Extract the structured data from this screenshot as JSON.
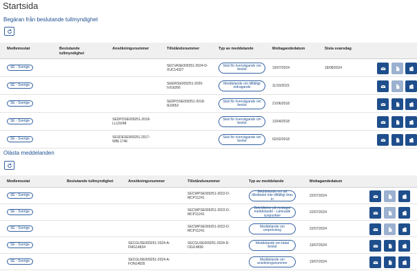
{
  "page_title": "Startsida",
  "section1": {
    "title": "Begäran från beslutande tullmyndighet",
    "headers": [
      "Medlemsstat",
      "Beslutande tullmyndighet",
      "Ansökningsnummer",
      "Tillståndsnummer",
      "Typ av meddelande",
      "Mottagandedatum",
      "Sista svarsdag"
    ],
    "rows": [
      {
        "country": "SE - Sverige",
        "authority": "",
        "application": "",
        "permit": "SECVASE009251-2024-D-XUC14327",
        "type": "Skäl för övervägande om beslut",
        "received": "19/07/2024",
        "deadline": "18/08/2024"
      },
      {
        "country": "SE - Sverige",
        "authority": "",
        "application": "",
        "permit": "SEEIRSE009251-2020-IVG9266",
        "type": "Meddelande om tillfälligt indragande",
        "received": "11/10/2023",
        "deadline": ""
      },
      {
        "country": "SE - Sverige",
        "authority": "",
        "application": "",
        "permit": "SEDPOSE009251-2018-IEI3652",
        "type": "Skäl för övervägande om beslut",
        "received": "21/06/2018",
        "deadline": ""
      },
      {
        "country": "SE - Sverige",
        "authority": "",
        "application": "SEDPOSE009251-2018-LLU3248",
        "permit": "",
        "type": "Skäl för övervägande om beslut",
        "received": "13/04/2018",
        "deadline": ""
      },
      {
        "country": "SE - Sverige",
        "authority": "",
        "application": "SESDESE009251-2017-WBL1746",
        "permit": "",
        "type": "Skäl för övervägande om beslut",
        "received": "02/02/2018",
        "deadline": ""
      }
    ]
  },
  "section2": {
    "title": "Olästa meddelanden",
    "headers": [
      "Medlemsstat",
      "Beslutande tullmyndighet",
      "Ansökningsnummer",
      "Tillståndsnummer",
      "Typ av meddelande",
      "Mottagandedatum"
    ],
    "rows": [
      {
        "country": "SE - Sverige",
        "authority": "",
        "application": "",
        "permit": "SECWPSE009251-2022-D-MCP11241",
        "type": "Meddelande om att tillståndet inte tillfälligt dras in",
        "received": "22/07/2024"
      },
      {
        "country": "SE - Sverige",
        "authority": "",
        "application": "",
        "permit": "SECWPSE009251-2022-D-MCP11241",
        "type": "Bekräftelse på mottaget meddelande - Lämnade synpunkter",
        "received": "22/07/2024"
      },
      {
        "country": "SE - Sverige",
        "authority": "",
        "application": "",
        "permit": "SECWPSE009251-2022-D-MCP11241",
        "type": "Meddelande om omprövning",
        "received": "22/07/2024"
      },
      {
        "country": "SE - Sverige",
        "authority": "",
        "application": "SECGUSE009251-2024-A-FMG14834",
        "permit": "SECGUSE009251-2024-D-OGI14836",
        "type": "Meddelande om fattat beslut",
        "received": "19/07/2024"
      },
      {
        "country": "SE - Sverige",
        "authority": "",
        "application": "SECGUSE009251-2024-A-FON14835",
        "permit": "",
        "type": "Meddelande om ansökningsnummer",
        "received": "19/07/2024"
      }
    ]
  },
  "icons": {
    "message": "envelope-icon",
    "document": "document-icon",
    "documents": "documents-icon",
    "refresh": "refresh-icon"
  },
  "colors": {
    "primary": "#1f4e8c",
    "disabled": "#9cb1cf",
    "link": "#1d4f91"
  }
}
